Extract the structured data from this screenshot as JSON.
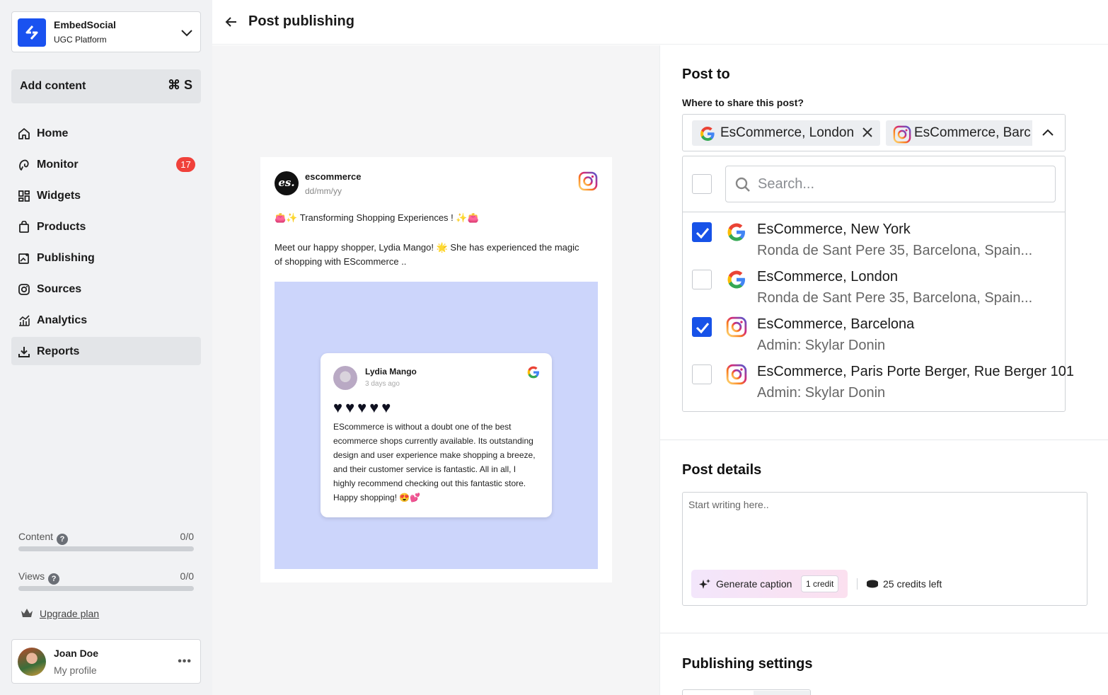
{
  "brand": {
    "name": "EmbedSocial",
    "subtitle": "UGC Platform"
  },
  "sidebar": {
    "add_content": {
      "label": "Add content",
      "shortcut": "⌘ S"
    },
    "items": [
      {
        "label": "Home",
        "icon": "home-icon"
      },
      {
        "label": "Monitor",
        "icon": "monitor-icon",
        "badge": "17"
      },
      {
        "label": "Widgets",
        "icon": "widgets-icon"
      },
      {
        "label": "Products",
        "icon": "products-icon"
      },
      {
        "label": "Publishing",
        "icon": "publishing-icon"
      },
      {
        "label": "Sources",
        "icon": "sources-icon"
      },
      {
        "label": "Analytics",
        "icon": "analytics-icon"
      },
      {
        "label": "Reports",
        "icon": "reports-icon",
        "active": true
      }
    ],
    "usage": [
      {
        "label": "Content",
        "value": "0/0",
        "progress": 0
      },
      {
        "label": "Views",
        "value": "0/0",
        "progress": 0
      }
    ],
    "upgrade_label": "Upgrade plan",
    "profile": {
      "name": "Joan Doe",
      "subtitle": "My profile"
    }
  },
  "header": {
    "title": "Post publishing"
  },
  "preview": {
    "username": "escommerce",
    "avatar_text": "es.",
    "date": "dd/mm/yy",
    "headline": "👛✨ Transforming Shopping Experiences ! ✨👛",
    "body": "Meet our happy shopper, Lydia Mango! 🌟 She has experienced the magic of shopping with EScommerce ..",
    "image_bg": "#ccd5fb",
    "review": {
      "name": "Lydia Mango",
      "date": "3 days ago",
      "stars": "♥♥♥♥♥",
      "rating": 5,
      "text": "EScommerce is without a doubt one of the best ecommerce shops currently available. Its outstanding design and user experience make shopping a breeze, and their customer service is fantastic. All in all, I highly recommend checking out this fantastic store. Happy shopping! 😍💕"
    }
  },
  "post_to": {
    "title": "Post to",
    "label": "Where to share this post?",
    "chips": [
      {
        "label": "EsCommerce, London",
        "icon": "google-icon"
      },
      {
        "label": "EsCommerce, Barc",
        "icon": "instagram-icon"
      }
    ],
    "search_placeholder": "Search...",
    "options": [
      {
        "title": "EsCommerce, New York",
        "subtitle": "Ronda de Sant Pere 35, Barcelona, Spain...",
        "icon": "google-icon",
        "checked": true
      },
      {
        "title": "EsCommerce, London",
        "subtitle": "Ronda de Sant Pere 35, Barcelona, Spain...",
        "icon": "google-icon",
        "checked": false
      },
      {
        "title": "EsCommerce, Barcelona",
        "subtitle": "Admin: Skylar Donin",
        "icon": "instagram-icon",
        "checked": true
      },
      {
        "title": "EsCommerce, Paris Porte Berger, Rue Berger 101",
        "subtitle": "Admin: Skylar Donin",
        "icon": "instagram-icon",
        "checked": false
      }
    ]
  },
  "post_details": {
    "title": "Post details",
    "placeholder": "Start writing here..",
    "generate_label": "Generate caption",
    "credit_badge": "1 credit",
    "credits_left": "25 credits left"
  },
  "publishing_settings": {
    "title": "Publishing settings"
  },
  "colors": {
    "accent": "#1752e8",
    "badge": "#f0413a",
    "sidebar_bg": "#f1f2f4"
  }
}
